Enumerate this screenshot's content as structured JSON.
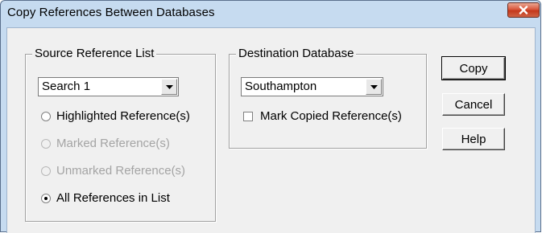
{
  "window": {
    "title": "Copy References Between Databases",
    "close_icon": "close-icon",
    "colors": {
      "title_bar": "#c6dbf0",
      "close_button": "#c4381b",
      "client": "#f0f0f0"
    }
  },
  "source": {
    "group_label": "Source Reference List",
    "list_value": "Search 1",
    "options": [
      {
        "label": "Highlighted Reference(s)",
        "selected": false,
        "enabled": true
      },
      {
        "label": "Marked Reference(s)",
        "selected": false,
        "enabled": false
      },
      {
        "label": "Unmarked Reference(s)",
        "selected": false,
        "enabled": false
      },
      {
        "label": "All References in List",
        "selected": true,
        "enabled": true
      }
    ]
  },
  "destination": {
    "group_label": "Destination Database",
    "database_value": "Southampton",
    "mark_copied_label": "Mark Copied Reference(s)",
    "mark_copied_checked": false
  },
  "buttons": {
    "copy": "Copy",
    "cancel": "Cancel",
    "help": "Help"
  }
}
